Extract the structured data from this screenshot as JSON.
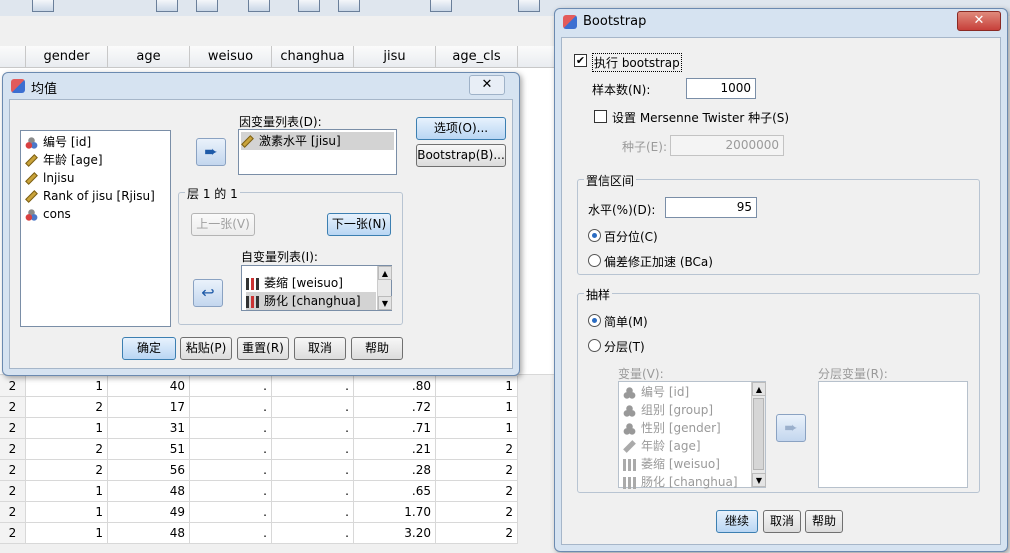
{
  "grid": {
    "columns": [
      "gender",
      "age",
      "weisuo",
      "changhua",
      "jisu",
      "age_cls"
    ],
    "rows": [
      [
        "2",
        "1",
        "40",
        ".",
        ".",
        ".80",
        "1"
      ],
      [
        "2",
        "2",
        "17",
        ".",
        ".",
        ".72",
        "1"
      ],
      [
        "2",
        "1",
        "31",
        ".",
        ".",
        ".71",
        "1"
      ],
      [
        "2",
        "2",
        "51",
        ".",
        ".",
        ".21",
        "2"
      ],
      [
        "2",
        "2",
        "56",
        ".",
        ".",
        ".28",
        "2"
      ],
      [
        "2",
        "1",
        "48",
        ".",
        ".",
        ".65",
        "2"
      ],
      [
        "2",
        "1",
        "49",
        ".",
        ".",
        "1.70",
        "2"
      ],
      [
        "2",
        "1",
        "48",
        ".",
        ".",
        "3.20",
        "2"
      ]
    ]
  },
  "means_dialog": {
    "title": "均值",
    "variables": [
      {
        "label": "编号 [id]",
        "icon": "nominal-icon"
      },
      {
        "label": "年龄 [age]",
        "icon": "scale-icon"
      },
      {
        "label": "lnjisu",
        "icon": "scale-icon"
      },
      {
        "label": "Rank of jisu [Rjisu]",
        "icon": "scale-icon"
      },
      {
        "label": "cons",
        "icon": "nominal-icon"
      }
    ],
    "dependent_label": "因变量列表(D):",
    "dependent_items": [
      "激素水平 [jisu]"
    ],
    "layer_label": "层 1 的 1",
    "prev_button": "上一张(V)",
    "next_button": "下一张(N)",
    "independent_label": "自变量列表(I):",
    "independent_items": [
      "萎缩 [weisuo]",
      "肠化 [changhua]"
    ],
    "options_button": "选项(O)...",
    "bootstrap_button": "Bootstrap(B)...",
    "ok_button": "确定",
    "paste_button": "粘贴(P)",
    "reset_button": "重置(R)",
    "cancel_button": "取消",
    "help_button": "帮助",
    "close_symbol": "✕"
  },
  "bootstrap_dialog": {
    "title": "Bootstrap",
    "perform_label": "执行 bootstrap",
    "perform_checked": true,
    "samples_label": "样本数(N):",
    "samples_value": "1000",
    "seed_checkbox_label": "设置 Mersenne Twister 种子(S)",
    "seed_label": "种子(E):",
    "seed_value": "2000000",
    "ci_group_label": "置信区间",
    "level_label": "水平(%)(D):",
    "level_value": "95",
    "percentile_label": "百分位(C)",
    "bca_label": "偏差修正加速 (BCa)",
    "sampling_group_label": "抽样",
    "simple_label": "简单(M)",
    "stratified_label": "分层(T)",
    "variables_label": "变量(V):",
    "strata_label": "分层变量(R):",
    "sampling_variables": [
      {
        "label": "编号 [id]",
        "icon": "nominal-icon"
      },
      {
        "label": "组别 [group]",
        "icon": "nominal-icon"
      },
      {
        "label": "性别 [gender]",
        "icon": "nominal-icon"
      },
      {
        "label": "年龄 [age]",
        "icon": "scale-icon"
      },
      {
        "label": "萎缩 [weisuo]",
        "icon": "ordinal-icon"
      },
      {
        "label": "肠化 [changhua]",
        "icon": "ordinal-icon"
      }
    ],
    "continue_button": "继续",
    "cancel_button": "取消",
    "help_button": "帮助",
    "close_symbol": "✕"
  },
  "colors": {
    "accent": "#3c7fb1",
    "close_red": "#c7403a"
  }
}
